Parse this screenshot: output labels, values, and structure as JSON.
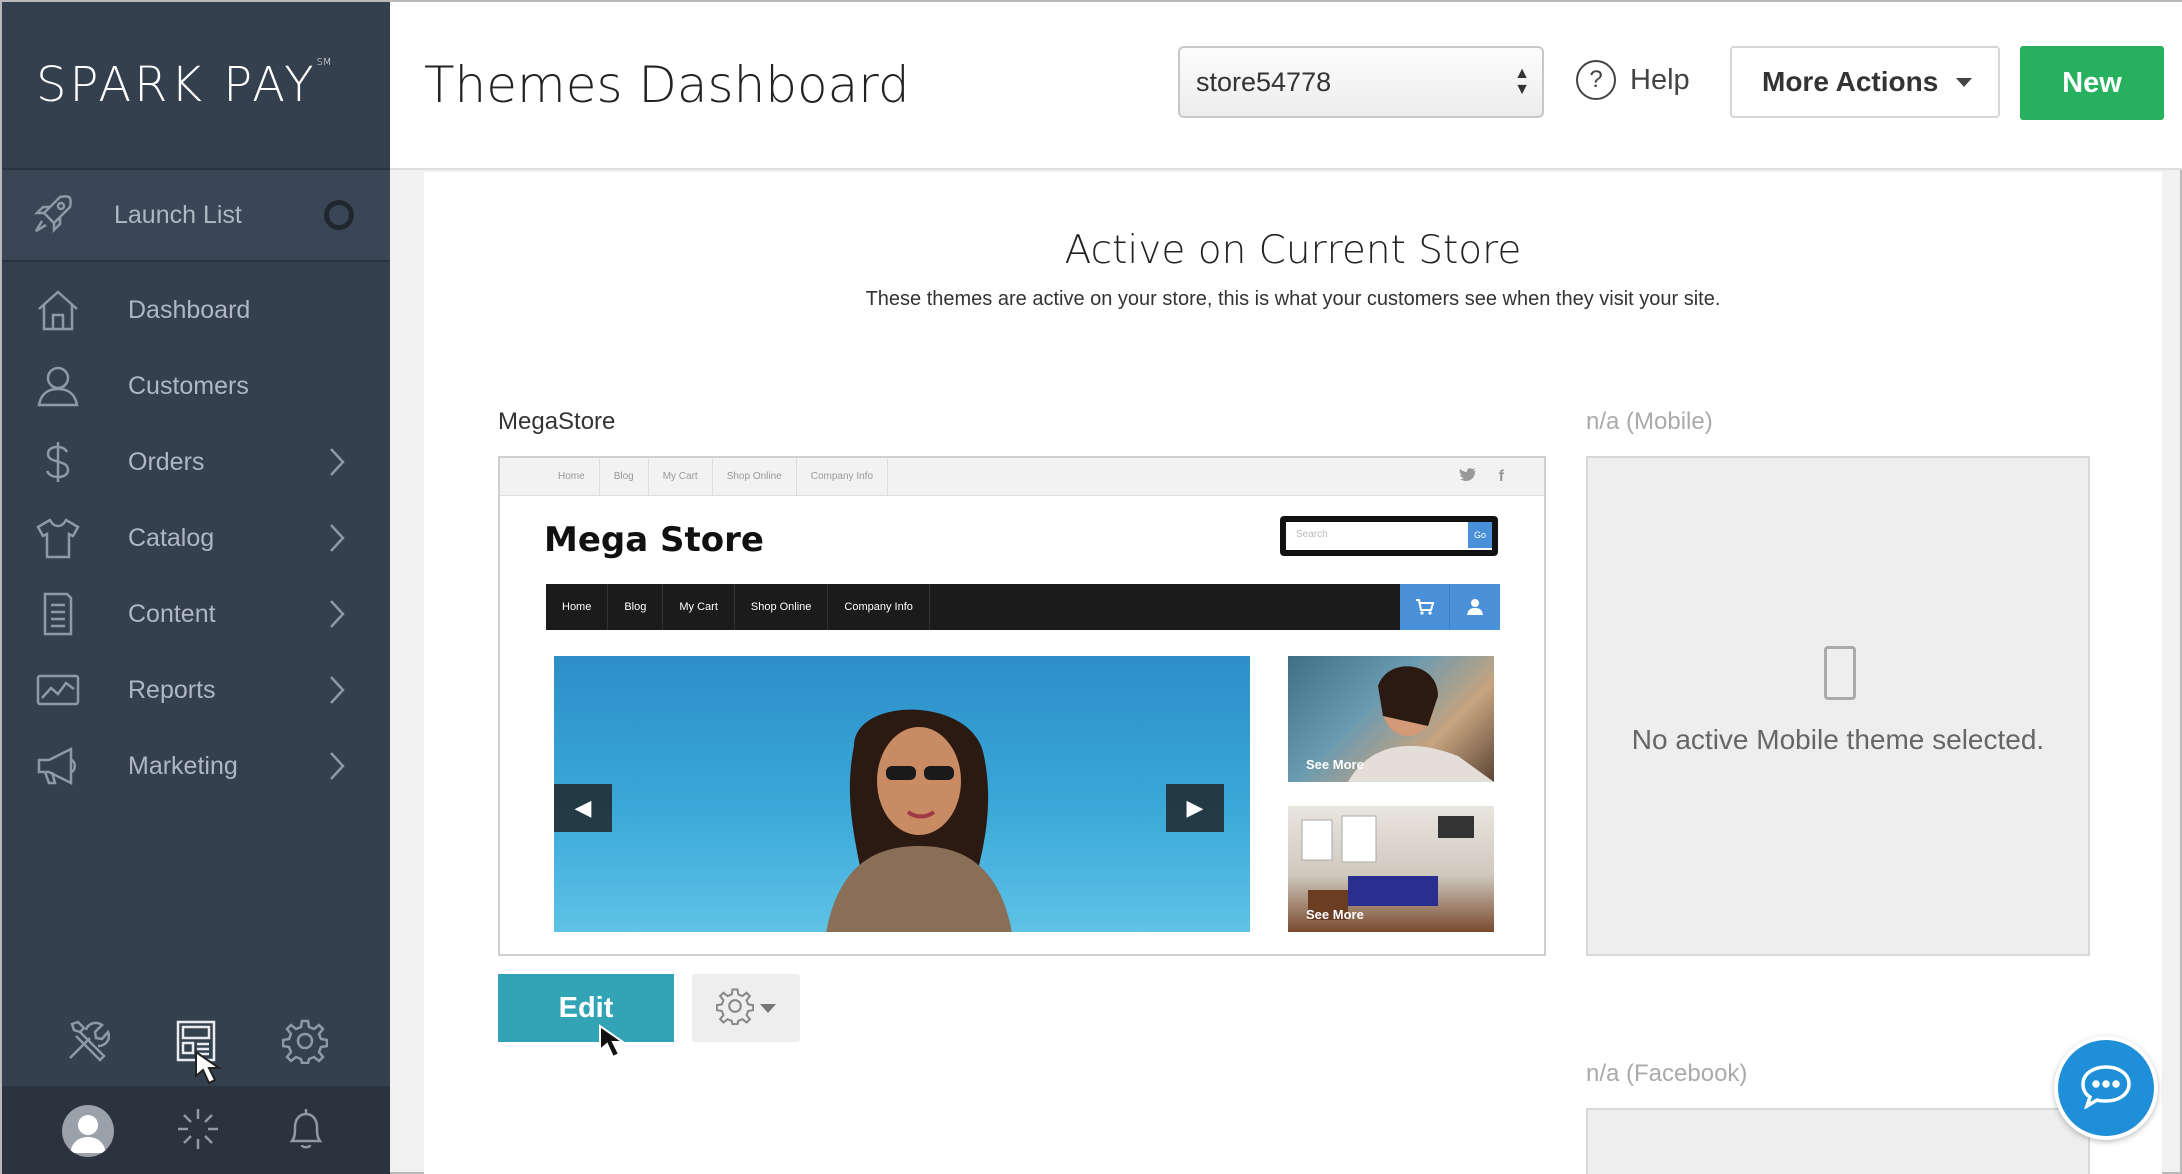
{
  "brand": {
    "logo_text": "SPARK PAY",
    "logo_mark": "SM"
  },
  "sidebar": {
    "launch_list": {
      "label": "Launch List",
      "icon": "rocket-icon"
    },
    "items": [
      {
        "label": "Dashboard",
        "icon": "home-icon",
        "has_submenu": false
      },
      {
        "label": "Customers",
        "icon": "user-icon",
        "has_submenu": true
      },
      {
        "label": "Orders",
        "icon": "dollar-icon",
        "has_submenu": true
      },
      {
        "label": "Catalog",
        "icon": "shirt-icon",
        "has_submenu": true
      },
      {
        "label": "Content",
        "icon": "document-icon",
        "has_submenu": true
      },
      {
        "label": "Reports",
        "icon": "chart-icon",
        "has_submenu": true
      },
      {
        "label": "Marketing",
        "icon": "megaphone-icon",
        "has_submenu": true
      }
    ],
    "tools": [
      "tools-icon",
      "themes-icon",
      "settings-icon"
    ],
    "bottom": [
      "avatar",
      "loading-icon",
      "bell-icon"
    ]
  },
  "header": {
    "title": "Themes Dashboard",
    "store_select": {
      "value": "store54778"
    },
    "help_label": "Help",
    "more_actions_label": "More Actions",
    "new_label": "New"
  },
  "main": {
    "section_title": "Active on Current Store",
    "section_subtitle": "These themes are active on your store, this is what your customers see when they visit your site.",
    "theme": {
      "name": "MegaStore",
      "preview": {
        "top_links": [
          "Home",
          "Blog",
          "My Cart",
          "Shop Online",
          "Company Info"
        ],
        "logo": "Mega Store",
        "search_placeholder": "Search",
        "search_button": "Go",
        "nav": [
          "Home",
          "Blog",
          "My Cart",
          "Shop Online",
          "Company Info"
        ],
        "thumb_caption_1": "See More",
        "thumb_caption_2": "See More"
      },
      "edit_label": "Edit"
    },
    "mobile": {
      "label": "n/a (Mobile)",
      "message": "No active Mobile theme selected."
    },
    "facebook": {
      "label": "n/a (Facebook)"
    }
  },
  "colors": {
    "sidebar_bg": "#35404f",
    "new_button": "#27b15e",
    "edit_button": "#33a3b6",
    "chat_button": "#1e8fd8"
  }
}
